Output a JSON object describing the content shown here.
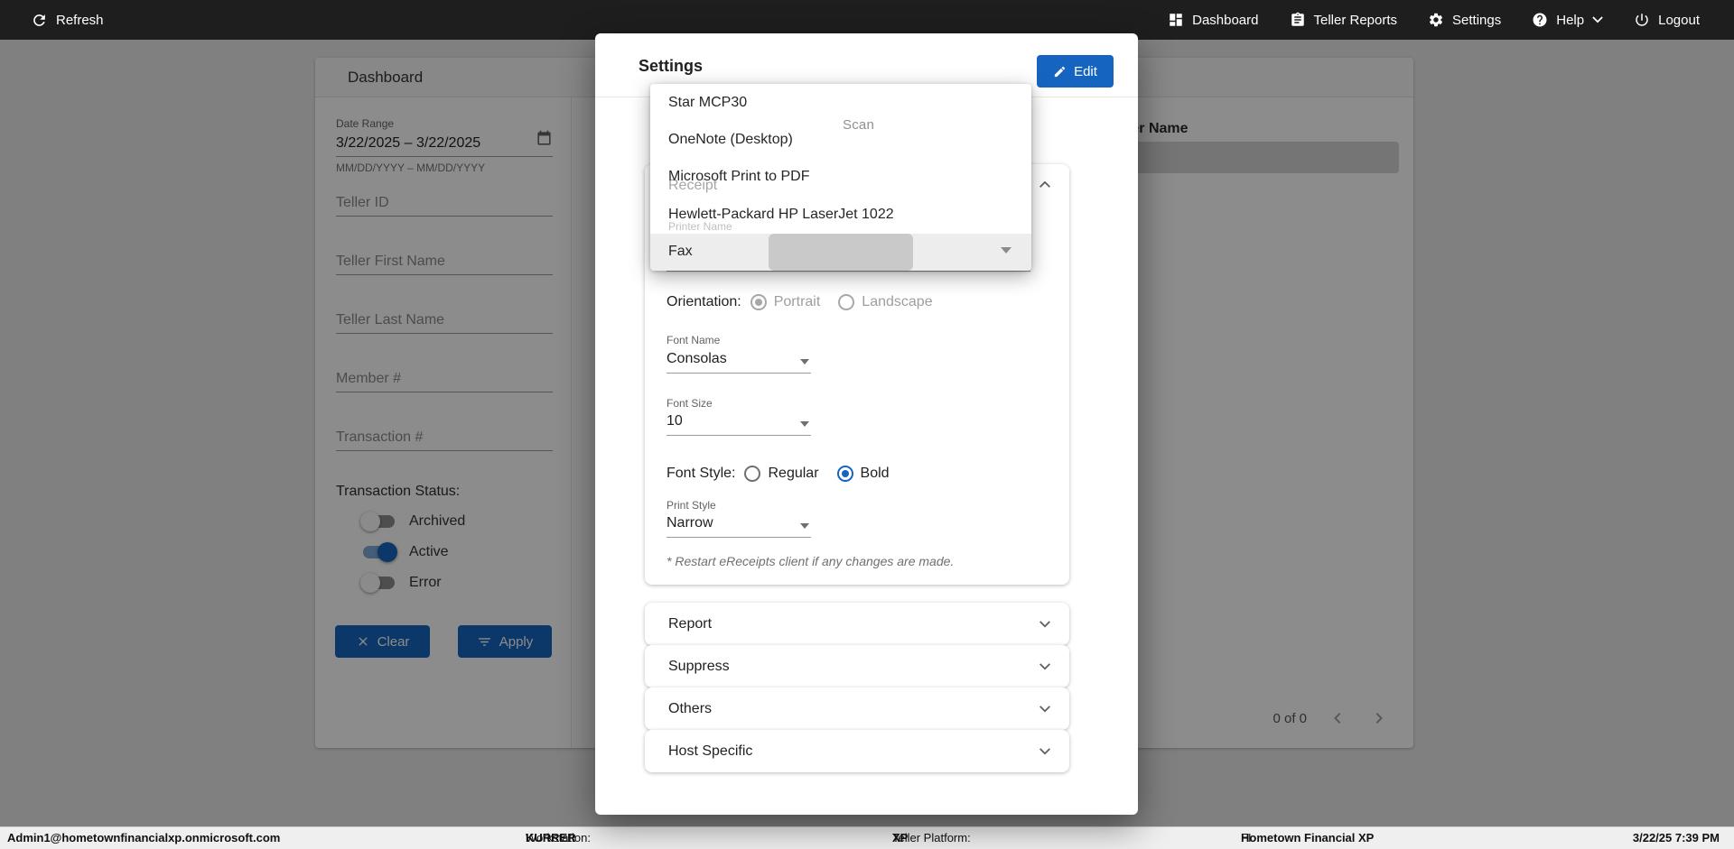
{
  "topbar": {
    "refresh_label": "Refresh",
    "nav": [
      {
        "label": "Dashboard"
      },
      {
        "label": "Teller Reports"
      },
      {
        "label": "Settings"
      },
      {
        "label": "Help"
      },
      {
        "label": "Logout"
      }
    ]
  },
  "dashboard": {
    "title": "Dashboard",
    "filters": {
      "date_range": {
        "label": "Date Range",
        "value": "3/22/2025 – 3/22/2025",
        "helper": "MM/DD/YYYY – MM/DD/YYYY"
      },
      "teller_id": "Teller ID",
      "teller_first_name": "Teller First Name",
      "teller_last_name": "Teller Last Name",
      "member": "Member #",
      "transaction": "Transaction #",
      "status_label": "Transaction Status:",
      "toggles": [
        {
          "label": "Archived",
          "state": "off"
        },
        {
          "label": "Active",
          "state": "on"
        },
        {
          "label": "Error",
          "state": "off"
        }
      ],
      "clear": "Clear",
      "apply": "Apply"
    },
    "table": {
      "header_teller_name": "Teller Name",
      "pagination": "0 of 0"
    }
  },
  "dialog": {
    "title": "Settings",
    "edit": "Edit",
    "tab": "Scan",
    "printer_menu": {
      "options": [
        "Star MCP30",
        "OneNote (Desktop)",
        "Microsoft Print to PDF",
        "Hewlett-Packard HP LaserJet 1022",
        "Fax"
      ],
      "selected": "Fax"
    },
    "receipt": {
      "title": "Receipt",
      "printer_label": "Printer Name",
      "orientation": {
        "label": "Orientation:",
        "options": [
          "Portrait",
          "Landscape"
        ],
        "selected": "Portrait"
      },
      "font_name": {
        "label": "Font Name",
        "value": "Consolas"
      },
      "font_size": {
        "label": "Font Size",
        "value": "10"
      },
      "font_style": {
        "label": "Font Style:",
        "options": [
          "Regular",
          "Bold"
        ],
        "selected": "Bold"
      },
      "print_style": {
        "label": "Print Style",
        "value": "Narrow"
      },
      "note": "* Restart eReceipts client if any changes are made."
    },
    "sections": [
      {
        "label": "Report"
      },
      {
        "label": "Suppress"
      },
      {
        "label": "Others"
      },
      {
        "label": "Host Specific"
      }
    ],
    "accent_color": "#1565c0"
  },
  "statusbar": {
    "user": "Admin1@hometownfinancialxp.onmicrosoft.com",
    "workstation_label": "Workstation:",
    "workstation": "KURRER",
    "platform_label": "Teller Platform:",
    "platform": "XP",
    "fi_label": "FI:",
    "fi": "Hometown Financial XP",
    "datetime": "3/22/25 7:39 PM"
  }
}
